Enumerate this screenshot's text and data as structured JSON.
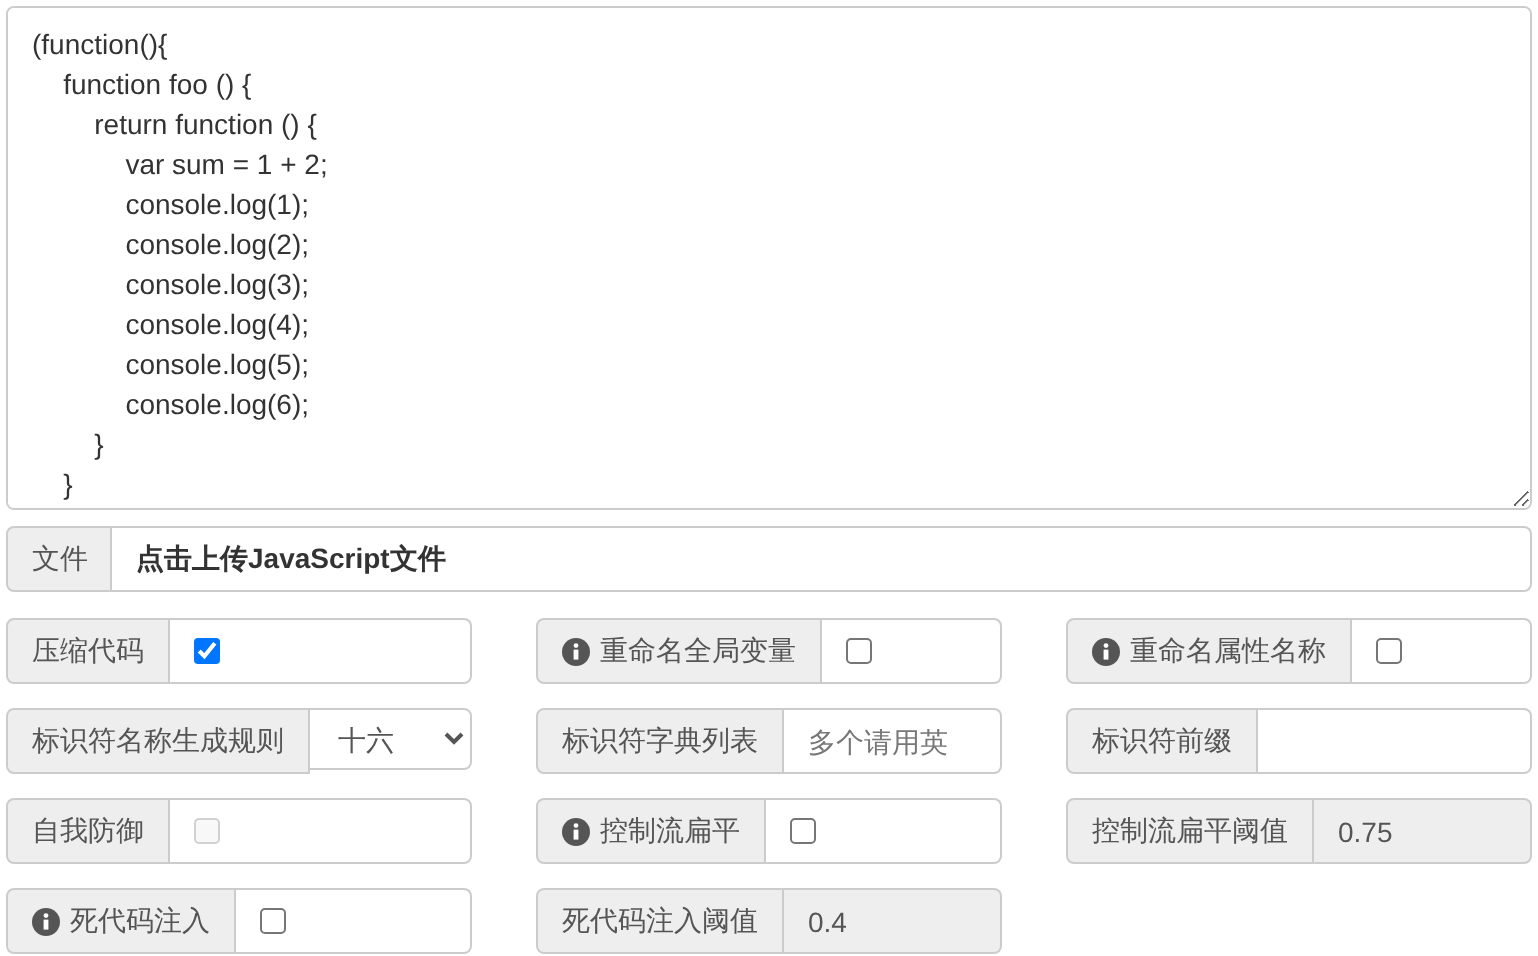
{
  "code": "(function(){\n    function foo () {\n        return function () {\n            var sum = 1 + 2;\n            console.log(1);\n            console.log(2);\n            console.log(3);\n            console.log(4);\n            console.log(5);\n            console.log(6);\n        }\n    }",
  "file": {
    "label": "文件",
    "value": "点击上传JavaScript文件"
  },
  "options": [
    {
      "kind": "checkbox",
      "label": "压缩代码",
      "info": false,
      "checked": true,
      "disabled": false
    },
    {
      "kind": "checkbox",
      "label": "重命名全局变量",
      "info": true,
      "checked": false,
      "disabled": false
    },
    {
      "kind": "checkbox",
      "label": "重命名属性名称",
      "info": true,
      "checked": false,
      "disabled": false
    },
    {
      "kind": "select",
      "label": "标识符名称生成规则",
      "info": false,
      "value": "十六"
    },
    {
      "kind": "text",
      "label": "标识符字典列表",
      "info": false,
      "placeholder": "多个请用英"
    },
    {
      "kind": "text",
      "label": "标识符前缀",
      "info": false
    },
    {
      "kind": "checkbox",
      "label": "自我防御",
      "info": false,
      "checked": false,
      "disabled": true
    },
    {
      "kind": "checkbox",
      "label": "控制流扁平",
      "info": true,
      "checked": false,
      "disabled": false
    },
    {
      "kind": "readonly",
      "label": "控制流扁平阈值",
      "info": false,
      "value": "0.75"
    },
    {
      "kind": "checkbox",
      "label": "死代码注入",
      "info": true,
      "checked": false,
      "disabled": false
    },
    {
      "kind": "readonly",
      "label": "死代码注入阈值",
      "info": false,
      "value": "0.4"
    }
  ]
}
